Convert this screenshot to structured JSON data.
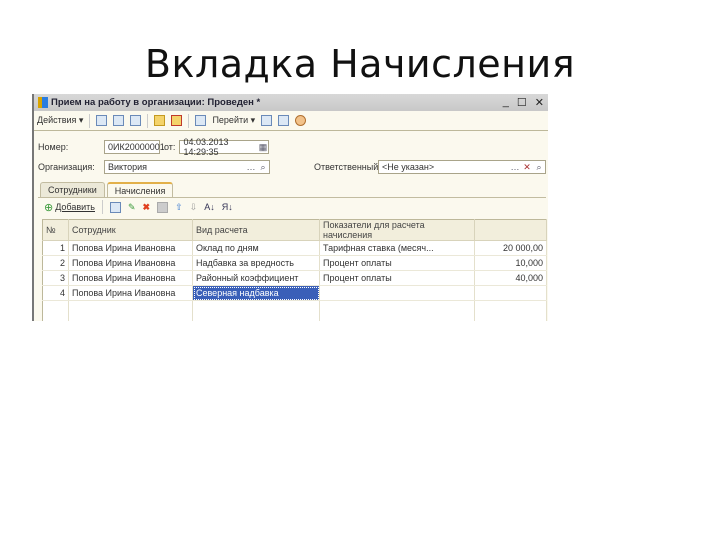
{
  "slide": {
    "title": "Вкладка Начисления"
  },
  "window": {
    "title": "Прием на работу в организации: Проведен *",
    "controls": [
      "_",
      "☐",
      "✕"
    ]
  },
  "toolbar": {
    "actions": "Действия ▾",
    "goto": "Перейти ▾"
  },
  "form": {
    "number_label": "Номер:",
    "number_value": "0ИК20000001",
    "date_label": "от:",
    "date_value": "04.03.2013 14:29:35",
    "org_label": "Организация:",
    "org_value": "Виктория",
    "resp_label": "Ответственный:",
    "resp_value": "<Не указан>"
  },
  "tabs": [
    {
      "label": "Сотрудники"
    },
    {
      "label": "Начисления",
      "active": true
    }
  ],
  "table_toolbar": {
    "add": "Добавить"
  },
  "table": {
    "headers": [
      "№",
      "Сотрудник",
      "Вид расчета",
      "Показатели для расчета начисления",
      ""
    ],
    "rows": [
      [
        "1",
        "Попова Ирина Ивановна",
        "Оклад по дням",
        "Тарифная ставка (месяч...",
        "20 000,00"
      ],
      [
        "2",
        "Попова Ирина Ивановна",
        "Надбавка за вредность",
        "Процент оплаты",
        "10,000"
      ],
      [
        "3",
        "Попова Ирина Ивановна",
        "Районный коэффициент",
        "Процент оплаты",
        "40,000"
      ],
      [
        "4",
        "Попова Ирина Ивановна",
        "Северная надбавка",
        "",
        ""
      ]
    ]
  }
}
